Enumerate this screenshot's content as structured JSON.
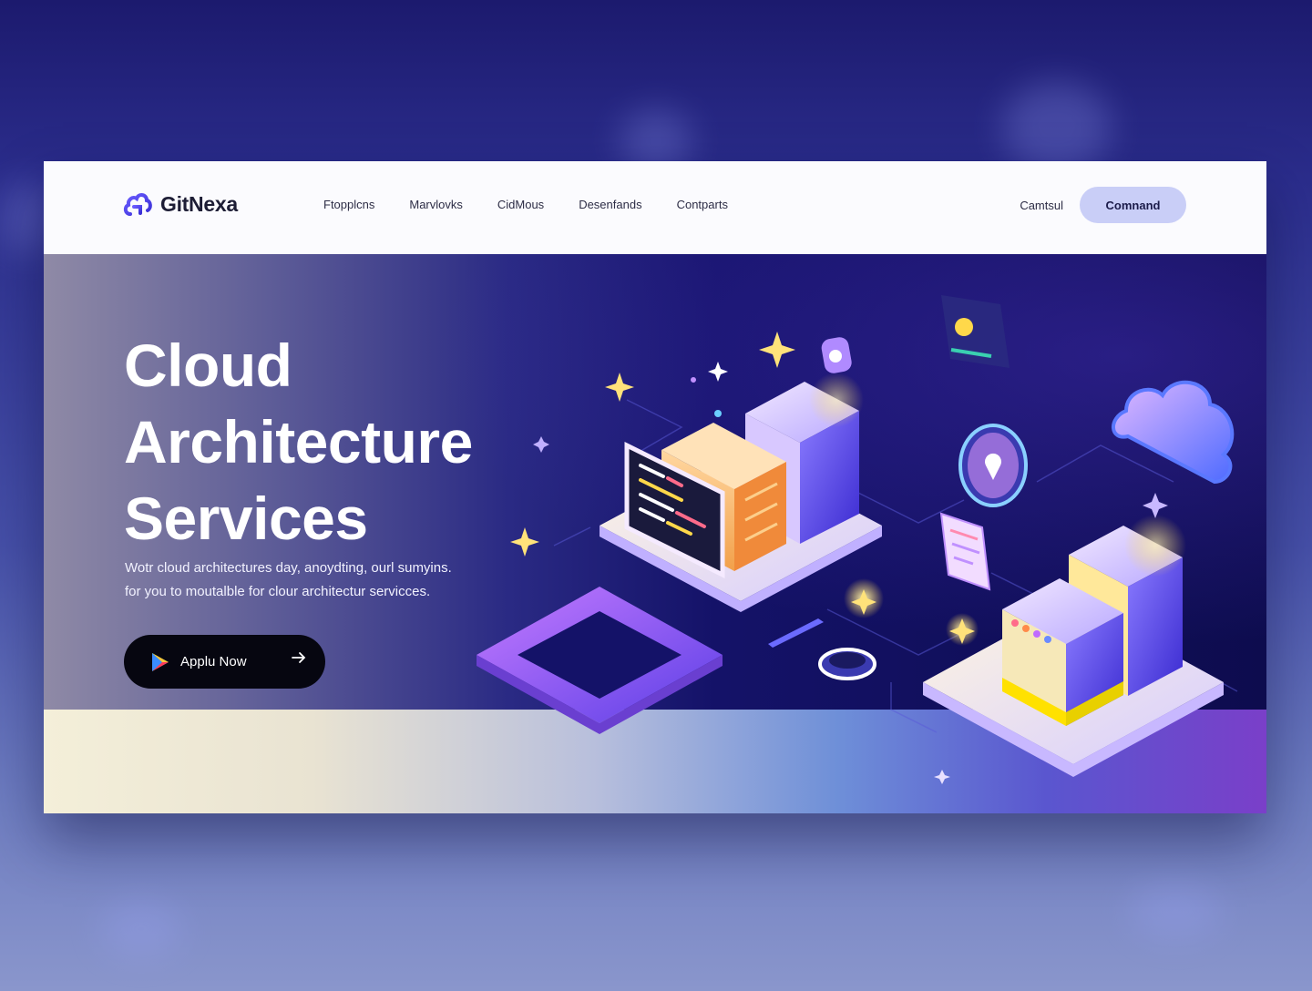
{
  "brand": {
    "name": "GitNexa"
  },
  "nav": {
    "links": [
      "Ftopplcns",
      "Marvlovks",
      "CidMous",
      "Desenfands",
      "Contparts"
    ],
    "contact_label": "Camtsul",
    "cta_label": "Comnand"
  },
  "hero": {
    "title_line1": "Cloud",
    "title_line2": "Architecture",
    "title_line3": "Services",
    "desc_line1": "Wotr cloud architectures day, anoydting, ourl sumyins.",
    "desc_line2": "for you to moutalble for clour architectur servicces.",
    "apply_label": "Applu Now"
  },
  "colors": {
    "accent": "#5a3fe0",
    "cta_bg": "#c9cef7",
    "button_dark": "#060610",
    "glow_yellow": "#ffd84a"
  },
  "icons": [
    "cloud-logo-icon",
    "play-icon",
    "arrow-right-icon",
    "cloud-icon",
    "server-icon",
    "location-pin-icon",
    "document-icon",
    "sparkle-icon"
  ]
}
